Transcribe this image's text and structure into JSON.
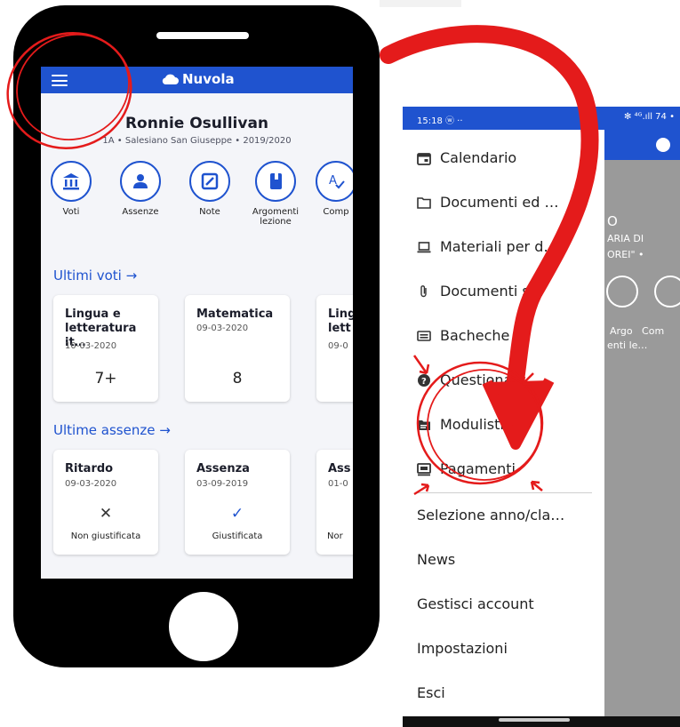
{
  "left_app": {
    "title": "Nuvola",
    "student_name": "Ronnie Osullivan",
    "student_sub": "1A • Salesiano San Giuseppe • 2019/2020",
    "quick_actions": [
      "Voti",
      "Assenze",
      "Note",
      "Argomenti lezione",
      "Comp"
    ],
    "section_grades": "Ultimi voti →",
    "grade_cards": [
      {
        "title": "Lingua e letteratura it…",
        "date": "10-03-2020",
        "grade": "7+"
      },
      {
        "title": "Matematica",
        "date": "09-03-2020",
        "grade": "8"
      },
      {
        "title": "Ling lett",
        "date": "09-0",
        "grade": ""
      }
    ],
    "section_absences": "Ultime assenze →",
    "absence_cards": [
      {
        "title": "Ritardo",
        "date": "09-03-2020",
        "mark": "✕",
        "state": "Non giustificata"
      },
      {
        "title": "Assenza",
        "date": "03-09-2019",
        "mark": "✓",
        "state": "Giustificata"
      },
      {
        "title": "Ass",
        "date": "01-0",
        "mark": "",
        "state": "Nor"
      }
    ]
  },
  "right_app": {
    "status_time": "15:18 ⓦ ··",
    "status_icons": "✻ ⁴ᴳ.ıll 74 •",
    "menu_items": [
      {
        "label": "Calendario",
        "icon": "calendar-icon"
      },
      {
        "label": "Documenti ed …",
        "icon": "folder-icon"
      },
      {
        "label": "Materiali per d…",
        "icon": "laptop-icon"
      },
      {
        "label": "Documenti s…",
        "icon": "paperclip-icon"
      },
      {
        "label": "Bacheche",
        "icon": "board-icon"
      },
      {
        "label": "Questionari",
        "icon": "question-icon"
      },
      {
        "label": "Modulistica",
        "icon": "folder-file-icon"
      },
      {
        "label": "Pagamenti",
        "icon": "payment-icon"
      }
    ],
    "text_items": [
      "Selezione anno/cla…",
      "News",
      "Gestisci account",
      "Impostazioni",
      "Esci"
    ],
    "background_fragments": {
      "o": "O",
      "l1": "ARIA DI",
      "l2": "OREI\" •",
      "l3": "Argo   Com",
      "l4": "enti le…"
    }
  },
  "colors": {
    "primary": "#1f53cf",
    "annotation_red": "#e41b1b"
  }
}
